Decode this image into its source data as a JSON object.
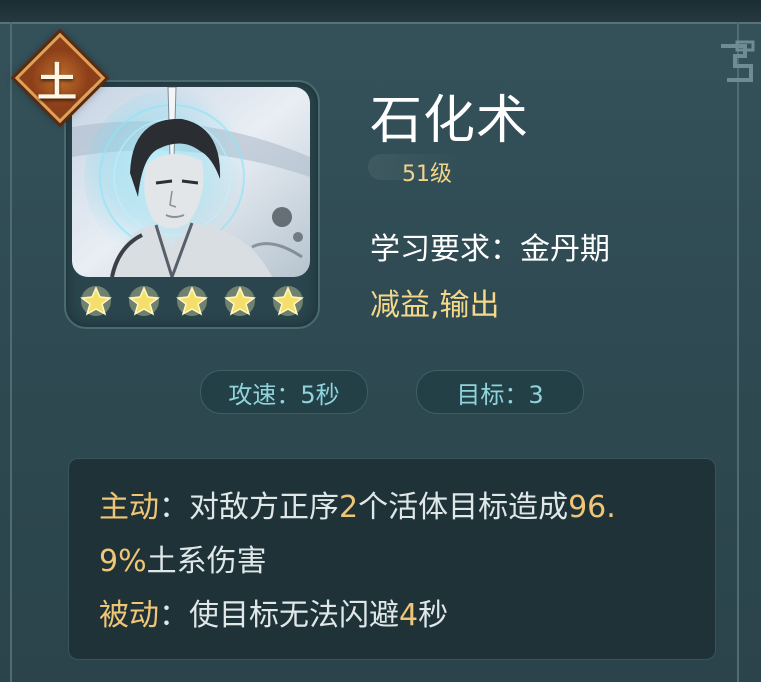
{
  "element_badge": {
    "glyph": "土"
  },
  "skill": {
    "name": "石化术",
    "level": "51级",
    "requirement": "学习要求：金丹期",
    "tags": "减益,输出",
    "stars": 5
  },
  "stats": {
    "attack_speed": "攻速：5秒",
    "targets": "目标：3"
  },
  "description": {
    "active_label": "主动",
    "active_sep": "：",
    "active_text_1": "对敌方正序",
    "active_num_1": "2",
    "active_text_2": "个活体目标造成",
    "active_num_2": "96.",
    "active_num_2b": "9%",
    "active_text_3": "土系伤害",
    "passive_label": "被动",
    "passive_sep": "：",
    "passive_text_1": "使目标无法闪避",
    "passive_num_1": "4",
    "passive_text_2": "秒"
  },
  "colors": {
    "highlight": "#f0c676",
    "tag_yellow": "#f5d98a",
    "stat_cyan": "#8fd3dd",
    "badge_orange": "#c0702f"
  },
  "icons": [
    "earth-element-icon",
    "star-icon"
  ]
}
